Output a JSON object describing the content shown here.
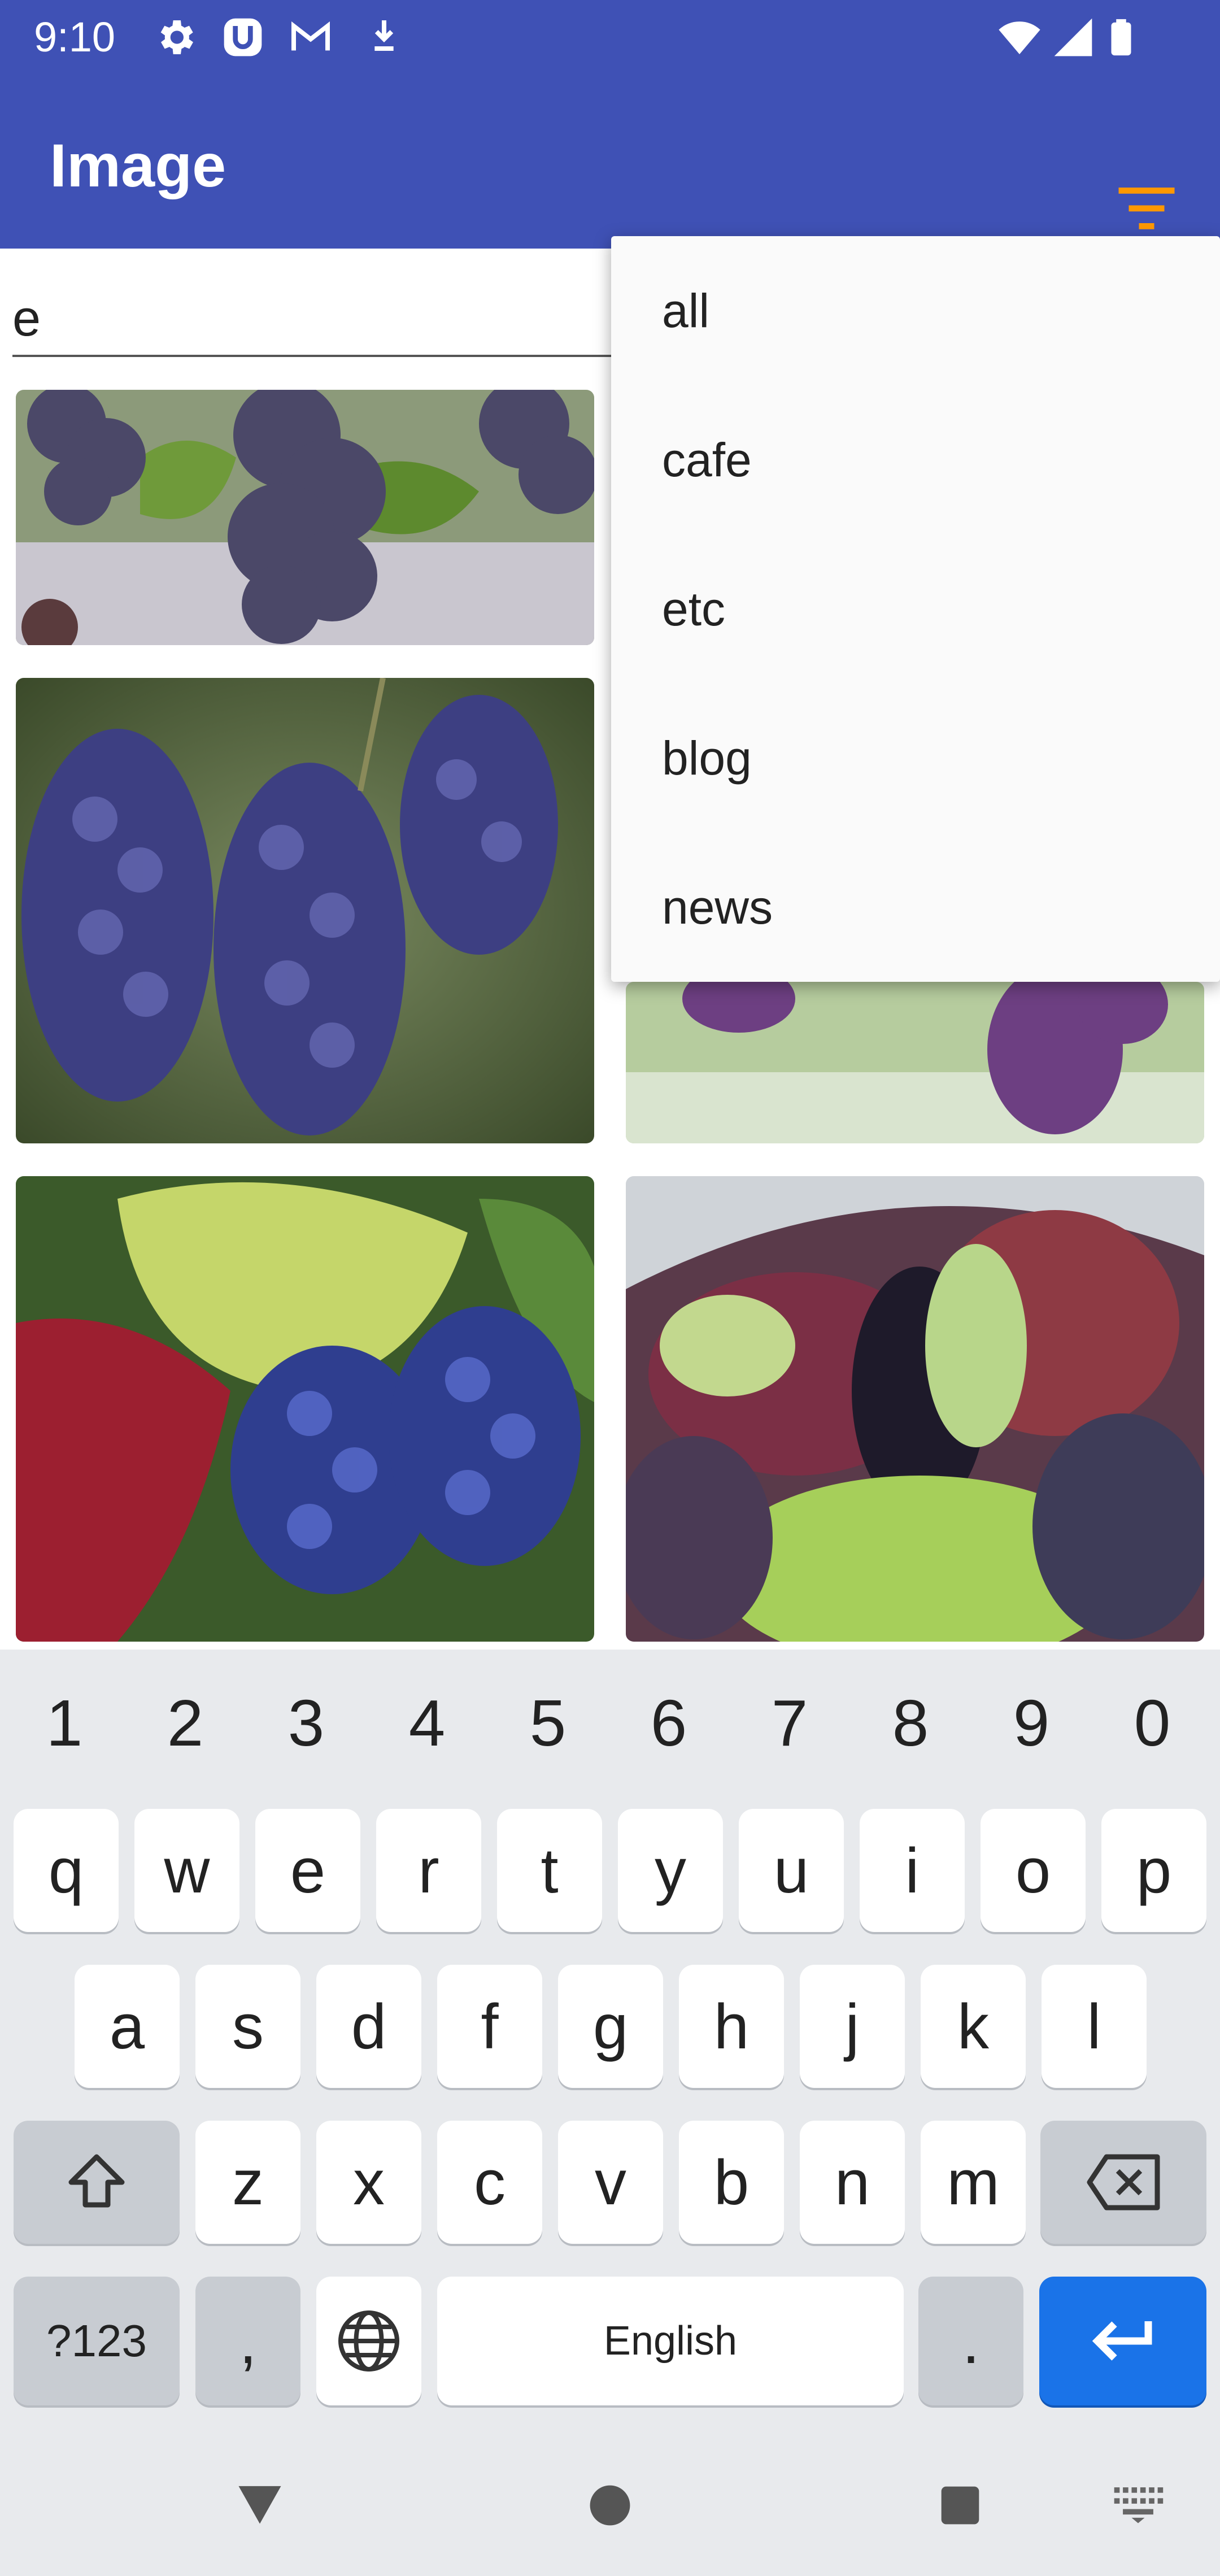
{
  "status_bar": {
    "time": "9:10",
    "icons": [
      "gear-icon",
      "u-app-icon",
      "gmail-icon",
      "download-icon",
      "wifi-icon",
      "signal-icon",
      "battery-icon"
    ]
  },
  "app_bar": {
    "title": "Image",
    "filter_icon": "filter-icon",
    "accent_color": "#ff9800",
    "bar_color": "#3f51b5"
  },
  "search": {
    "value": "e"
  },
  "dropdown": {
    "items": [
      "all",
      "cafe",
      "etc",
      "blog",
      "news"
    ]
  },
  "images": [
    "grape-image",
    "grape-image",
    "grape-image",
    "grape-image",
    "grape-image",
    "grape-image"
  ],
  "keyboard": {
    "numbers": [
      "1",
      "2",
      "3",
      "4",
      "5",
      "6",
      "7",
      "8",
      "9",
      "0"
    ],
    "row1": [
      "q",
      "w",
      "e",
      "r",
      "t",
      "y",
      "u",
      "i",
      "o",
      "p"
    ],
    "row2": [
      "a",
      "s",
      "d",
      "f",
      "g",
      "h",
      "j",
      "k",
      "l"
    ],
    "row3": [
      "z",
      "x",
      "c",
      "v",
      "b",
      "n",
      "m"
    ],
    "symbols_key": "?123",
    "comma_key": ",",
    "space_label": "English",
    "period_key": ".",
    "enter_color": "#1a73e8"
  },
  "nav": {
    "icons": [
      "back-icon",
      "home-icon",
      "recents-icon",
      "keyboard-switch-icon"
    ]
  }
}
